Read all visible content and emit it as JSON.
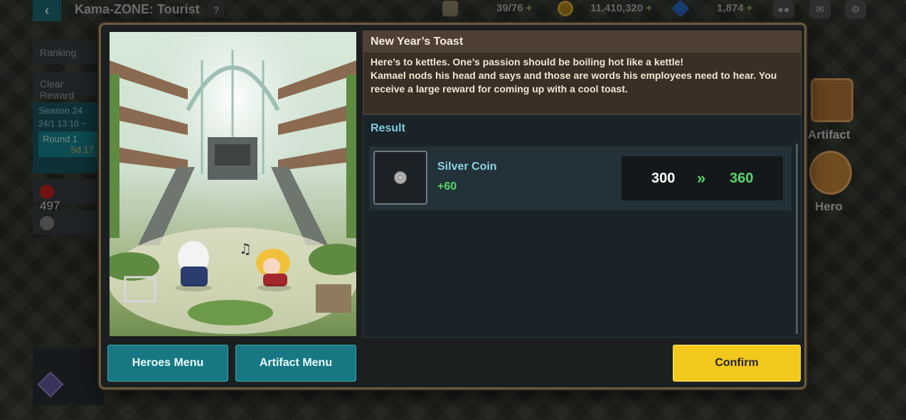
{
  "topbar": {
    "back_icon": "chevron-left-icon",
    "zone_title": "Kama-ZONE: Tourist",
    "help_label": "?",
    "stamina": "39/76",
    "gold": "11,410,320",
    "gems": "1,874",
    "plus": "+"
  },
  "left_panel": {
    "ranking": "Ranking",
    "clear_reward": "Clear Reward",
    "season": "Season 24",
    "season_date": "24/1 13:10 ~",
    "round": "Round 1",
    "round_time": "5d 17",
    "score": "497"
  },
  "right_panel": {
    "artifact": "Artifact",
    "hero": "Hero"
  },
  "dialog": {
    "event_title": "New Year’s Toast",
    "event_line1": "Here’s to kettles. One’s passion should be boiling hot like a kettle!",
    "event_line2": "Kamael nods his head and says and those are words his employees need to hear. You receive a large reward for coming up with a cool toast.",
    "result_label": "Result",
    "result": {
      "item_name": "Silver Coin",
      "gain": "+60",
      "old_value": "300",
      "arrow": "»",
      "new_value": "360"
    },
    "buttons": {
      "heroes": "Heroes Menu",
      "artifact": "Artifact Menu",
      "confirm": "Confirm"
    }
  },
  "colors": {
    "accent_teal": "#177883",
    "confirm_yellow": "#f3c81d",
    "gain_green": "#53d86a",
    "result_blue": "#7fc9df"
  }
}
